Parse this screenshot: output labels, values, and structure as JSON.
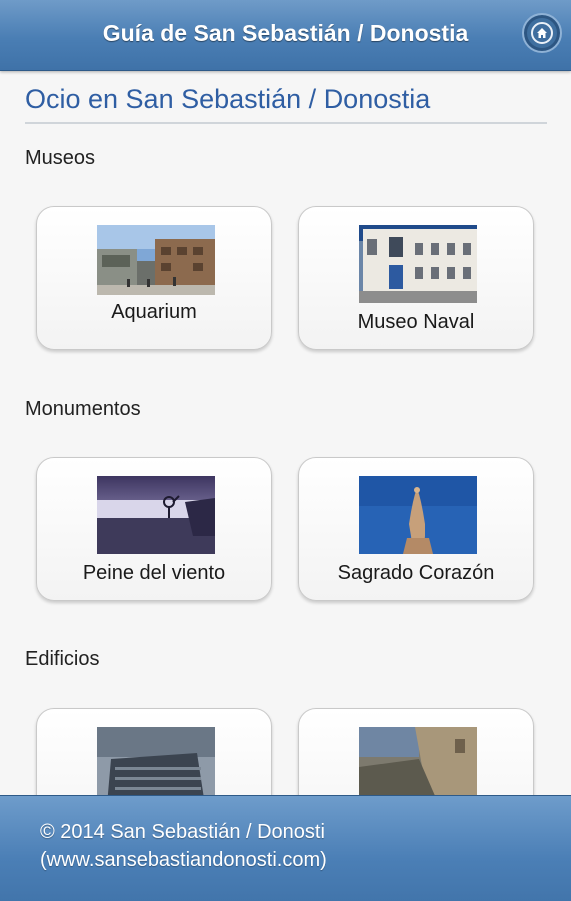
{
  "header": {
    "title": "Guía de San Sebastián / Donostia",
    "home_icon": "home-icon"
  },
  "page": {
    "title": "Ocio en San Sebastián / Donostia"
  },
  "sections": [
    {
      "title": "Museos",
      "items": [
        {
          "label": "Aquarium"
        },
        {
          "label": "Museo Naval"
        }
      ]
    },
    {
      "title": "Monumentos",
      "items": [
        {
          "label": "Peine del viento"
        },
        {
          "label": "Sagrado Corazón"
        }
      ]
    },
    {
      "title": "Edificios",
      "items": [
        {
          "label": ""
        },
        {
          "label": ""
        }
      ]
    }
  ],
  "footer": {
    "copyright": "© 2014 San Sebastián / Donosti",
    "url": "(www.sansebastiandonosti.com)"
  },
  "colors": {
    "header": "#4a7eb4",
    "title": "#2f5ea3",
    "footer": "#4b7fb6"
  }
}
